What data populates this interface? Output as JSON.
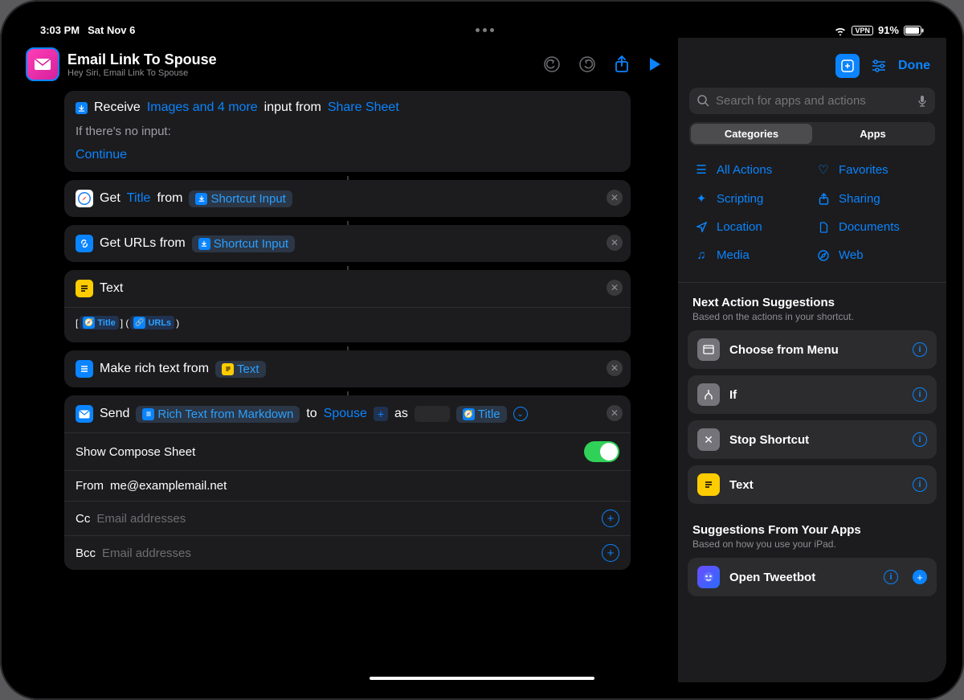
{
  "status": {
    "time": "3:03 PM",
    "date": "Sat Nov 6",
    "vpn": "VPN",
    "battery": "91%"
  },
  "header": {
    "title": "Email Link To Spouse",
    "subtitle": "Hey Siri, Email Link To Spouse"
  },
  "sidebar": {
    "done": "Done",
    "search_placeholder": "Search for apps and actions",
    "seg_categories": "Categories",
    "seg_apps": "Apps",
    "cats": {
      "all": "All Actions",
      "fav": "Favorites",
      "script": "Scripting",
      "share": "Sharing",
      "loc": "Location",
      "docs": "Documents",
      "media": "Media",
      "web": "Web"
    },
    "suggest_title": "Next Action Suggestions",
    "suggest_sub": "Based on the actions in your shortcut.",
    "suggestions": {
      "choose": "Choose from Menu",
      "ifx": "If",
      "stop": "Stop Shortcut",
      "text": "Text"
    },
    "apps_title": "Suggestions From Your Apps",
    "apps_sub": "Based on how you use your iPad.",
    "app_suggestions": {
      "tweetbot": "Open Tweetbot"
    }
  },
  "steps": {
    "receive": {
      "word_receive": "Receive",
      "types": "Images and 4 more",
      "word_input_from": "input from",
      "source": "Share Sheet",
      "no_input_label": "If there's no input:",
      "continue": "Continue"
    },
    "get_title": {
      "word_get": "Get",
      "title": "Title",
      "word_from": "from",
      "var": "Shortcut Input"
    },
    "get_urls": {
      "label": "Get URLs from",
      "var": "Shortcut Input"
    },
    "text": {
      "label": "Text",
      "body_open": "[ ",
      "body_title": "Title",
      "body_mid": " ] ( ",
      "body_urls": "URLs",
      "body_close": " )"
    },
    "rich": {
      "label": "Make rich text from",
      "var": "Text"
    },
    "send": {
      "word_send": "Send",
      "rich": "Rich Text from Markdown",
      "word_to": "to",
      "spouse": "Spouse",
      "word_as": "as",
      "title": "Title"
    },
    "mail": {
      "compose_label": "Show Compose Sheet",
      "from_label": "From",
      "from_value": "me@examplemail.net",
      "cc_label": "Cc",
      "bcc_label": "Bcc",
      "placeholder": "Email addresses"
    }
  }
}
